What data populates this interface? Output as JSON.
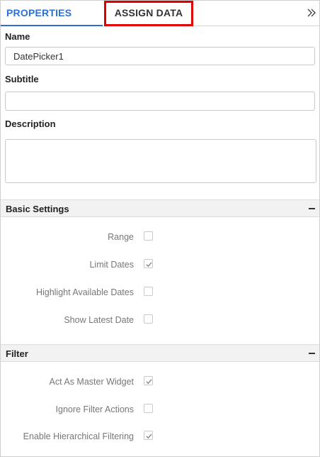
{
  "tabs": {
    "properties": "PROPERTIES",
    "assign_data": "ASSIGN DATA"
  },
  "icons": {
    "collapse": "double-chevron-right-icon",
    "section_toggle": "minus-icon",
    "check": "check-icon"
  },
  "colors": {
    "active_tab": "#2e6fd1",
    "highlight_box": "#e00000"
  },
  "fields": {
    "name": {
      "label": "Name",
      "value": "DatePicker1"
    },
    "subtitle": {
      "label": "Subtitle",
      "value": ""
    },
    "description": {
      "label": "Description",
      "value": ""
    }
  },
  "sections": {
    "basic_settings": {
      "title": "Basic Settings",
      "items": [
        {
          "label": "Range",
          "checked": false
        },
        {
          "label": "Limit Dates",
          "checked": true
        },
        {
          "label": "Highlight Available Dates",
          "checked": false
        },
        {
          "label": "Show Latest Date",
          "checked": false
        }
      ]
    },
    "filter": {
      "title": "Filter",
      "items": [
        {
          "label": "Act As Master Widget",
          "checked": true
        },
        {
          "label": "Ignore Filter Actions",
          "checked": false
        },
        {
          "label": "Enable Hierarchical Filtering",
          "checked": true
        }
      ]
    }
  }
}
